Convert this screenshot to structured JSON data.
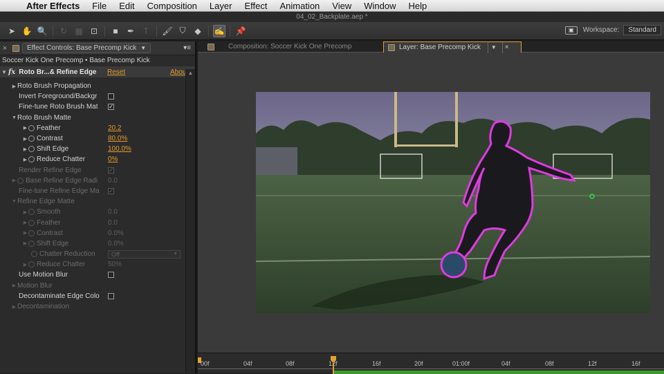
{
  "menubar": {
    "app_name": "After Effects",
    "items": [
      "File",
      "Edit",
      "Composition",
      "Layer",
      "Effect",
      "Animation",
      "View",
      "Window",
      "Help"
    ]
  },
  "window": {
    "title": "04_02_Backplate.aep *"
  },
  "toolbar": {
    "workspace_label": "Workspace:",
    "workspace_value": "Standard"
  },
  "left_panel": {
    "tab_label": "Effect Controls: Base Precomp Kick",
    "layer_path": "Soccer Kick One Precomp • Base Precomp Kick",
    "effect": {
      "name": "Roto Br...& Refine Edge",
      "reset": "Reset",
      "about": "Abou"
    },
    "props": [
      {
        "label": "Roto Brush Propagation"
      },
      {
        "label": "Invert Foreground/Backgr",
        "check": ""
      },
      {
        "label": "Fine-tune Roto Brush Mat",
        "check": "✓"
      },
      {
        "label": "Roto Brush Matte"
      },
      {
        "label": "Feather",
        "value": "20.2"
      },
      {
        "label": "Contrast",
        "value": "80.0%"
      },
      {
        "label": "Shift Edge",
        "value": "100.0%"
      },
      {
        "label": "Reduce Chatter",
        "value": "0%"
      },
      {
        "label": "Render Refine Edge",
        "check": "✓"
      },
      {
        "label": "Base Refine Edge Radi",
        "value": "0.0"
      },
      {
        "label": "Fine-tune Refine Edge Ma",
        "check": "✓"
      },
      {
        "label": "Refine Edge Matte"
      },
      {
        "label": "Smooth",
        "value": "0.0"
      },
      {
        "label": "Feather",
        "value": "0.0"
      },
      {
        "label": "Contrast",
        "value": "0.0%"
      },
      {
        "label": "Shift Edge",
        "value": "0.0%"
      },
      {
        "label": "Chatter Reduction",
        "value": "Off"
      },
      {
        "label": "Reduce Chatter",
        "value": "50%"
      },
      {
        "label": "Use Motion Blur",
        "check": ""
      },
      {
        "label": "Motion Blur"
      },
      {
        "label": "Decontaminate Edge Colo",
        "check": ""
      },
      {
        "label": "Decontamination"
      }
    ]
  },
  "viewer": {
    "tabs": [
      {
        "label": "Composition: Soccer Kick One Precomp"
      },
      {
        "label": "Layer: Base Precomp Kick"
      }
    ]
  },
  "timeline": {
    "ticks": [
      "00f",
      "04f",
      "08f",
      "12f",
      "16f",
      "20f",
      "01:00f",
      "04f",
      "08f",
      "12f",
      "16f"
    ]
  }
}
